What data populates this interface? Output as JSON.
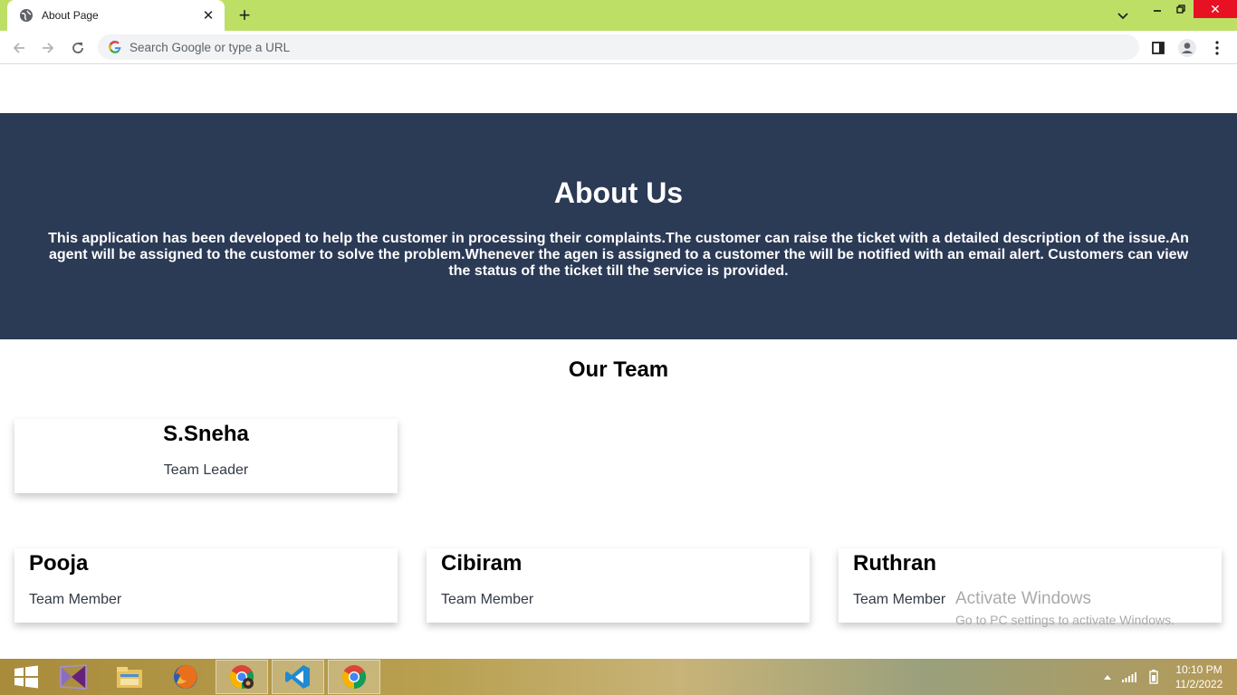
{
  "browser": {
    "tab_title": "About Page",
    "address_placeholder": "Search Google or type a URL",
    "tabstrip_color": "#bddf66"
  },
  "hero": {
    "title": "About Us",
    "description": "This application has been developed to help the customer in processing their complaints.The customer can raise the ticket with a detailed description of the issue.An agent will be assigned to the customer to solve the problem.Whenever the agen is assigned to a customer the will be notified with an email alert. Customers can view the status of the ticket till the service is provided.",
    "background": "#2b3a55"
  },
  "team": {
    "title": "Our Team",
    "leader": {
      "name": "S.Sneha",
      "role": "Team Leader"
    },
    "members": [
      {
        "name": "Pooja",
        "role": "Team Member"
      },
      {
        "name": "Cibiram",
        "role": "Team Member"
      },
      {
        "name": "Ruthran",
        "role": "Team Member"
      }
    ]
  },
  "watermark": {
    "line1": "Activate Windows",
    "line2": "Go to PC settings to activate Windows."
  },
  "taskbar": {
    "apps": [
      "start-icon",
      "visual-studio-icon",
      "file-explorer-icon",
      "firefox-icon",
      "chrome-icon",
      "vscode-icon",
      "chrome-icon"
    ],
    "time": "10:10 PM",
    "date": "11/2/2022"
  }
}
